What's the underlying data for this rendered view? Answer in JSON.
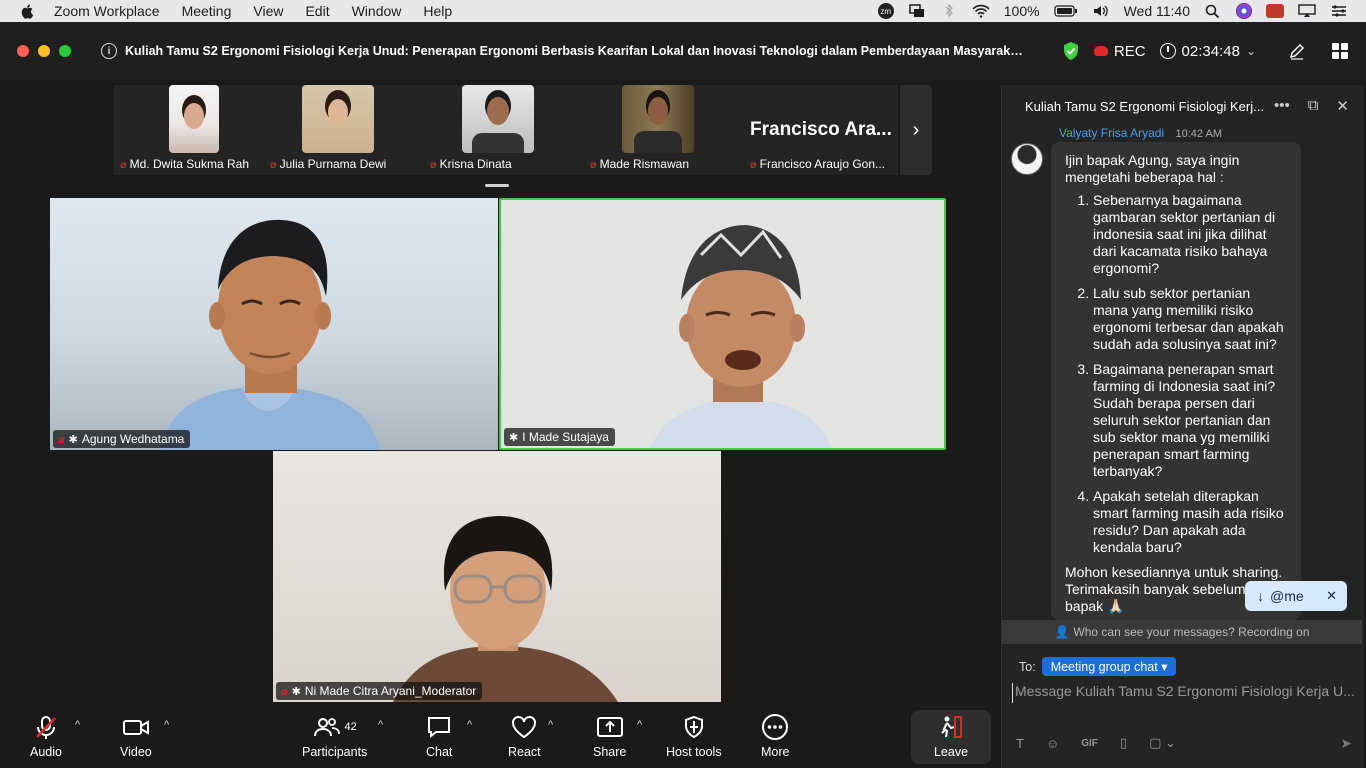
{
  "menubar": {
    "app": "Zoom Workplace",
    "items": [
      "Meeting",
      "View",
      "Edit",
      "Window",
      "Help"
    ],
    "battery": "100%",
    "clock": "Wed 11:40",
    "icons": [
      "apple-icon",
      "zoom-badge-icon",
      "screen-icon",
      "bluetooth-icon",
      "wifi-icon",
      "battery-icon",
      "volume-icon",
      "search-icon",
      "siri-icon",
      "vpn-icon",
      "display-icon",
      "control-center-icon"
    ]
  },
  "window": {
    "title": "Kuliah Tamu S2 Ergonomi Fisiologi Kerja Unud: Penerapan Ergonomi Berbasis Kearifan Lokal dan Inovasi Teknologi dalam Pemberdayaan Masyarakat Perta...",
    "rec_label": "REC",
    "timer": "02:34:48",
    "accent_green": "#3ed040",
    "rec_red": "#e02828"
  },
  "thumbnails": [
    {
      "name": "Md. Dwita Sukma Rah"
    },
    {
      "name": "Julia Purnama Dewi"
    },
    {
      "name": "Krisna Dinata"
    },
    {
      "name": "Made Rismawan"
    },
    {
      "name": "Francisco Araujo Gon...",
      "big_label": "Francisco Ara..."
    }
  ],
  "tiles": [
    {
      "name": "Agung Wedhatama"
    },
    {
      "name": "I Made Sutajaya"
    },
    {
      "name": "Ni Made Citra Aryani_Moderator"
    }
  ],
  "chat": {
    "header_title": "Kuliah Tamu S2 Ergonomi Fisiologi Kerj...",
    "sender": "Valyaty Frisa Aryadi",
    "time": "10:42 AM",
    "intro": "Ijin bapak Agung, saya ingin mengetahi beberapa hal :",
    "questions": [
      "Sebenarnya bagaimana gambaran sektor pertanian di indonesia saat ini jika dilihat dari kacamata risiko bahaya ergonomi?",
      "Lalu sub sektor pertanian mana yang memiliki risiko ergonomi terbesar dan apakah sudah ada solusinya saat ini?",
      "Bagaimana penerapan smart farming di Indonesia saat ini? Sudah berapa persen dari seluruh sektor pertanian dan sub sektor mana yg memiliki penerapan smart farming terbanyak?",
      "Apakah setelah diterapkan smart farming masih ada risiko residu? Dan apakah ada kendala baru?"
    ],
    "closing": "Mohon kesediannya untuk sharing. Terimakasih banyak sebelumnya bapak 🙏🏻",
    "mention_pill": "@me",
    "visibility_note": "Who can see your messages? Recording on",
    "to_label": "To:",
    "to_target": "Meeting group chat",
    "input_placeholder": "Message Kuliah Tamu S2 Ergonomi Fisiologi Kerja U...",
    "composer_icons": [
      "text-format-icon",
      "emoji-icon",
      "gif-icon",
      "file-icon",
      "screenshot-icon",
      "send-icon"
    ],
    "gif_label": "GIF"
  },
  "toolbar": {
    "audio": "Audio",
    "video": "Video",
    "participants": "Participants",
    "participants_count": "42",
    "chat": "Chat",
    "react": "React",
    "share": "Share",
    "host_tools": "Host tools",
    "more": "More",
    "leave": "Leave"
  }
}
